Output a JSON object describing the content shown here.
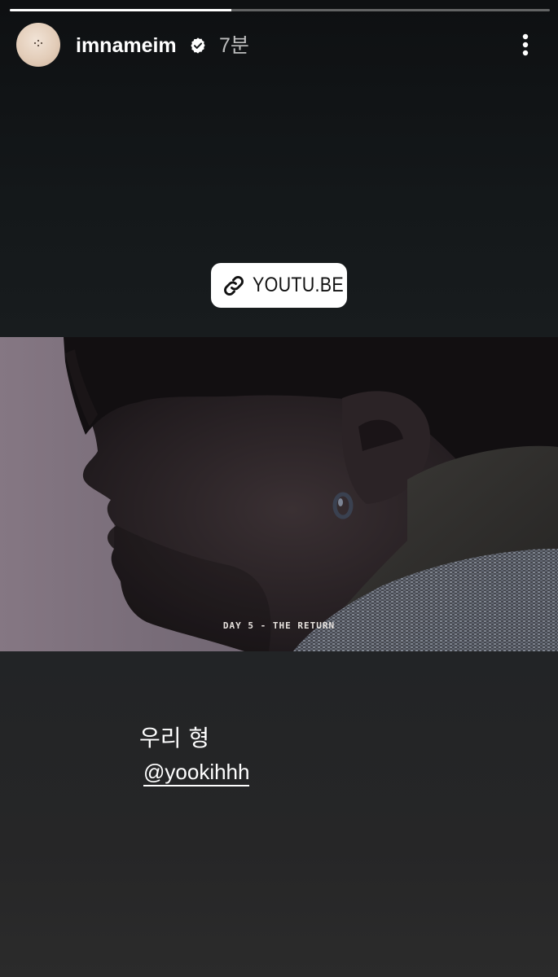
{
  "story": {
    "progress": 0.41,
    "account": {
      "username": "imnameim",
      "verified": true,
      "time_ago": "7분",
      "avatar_icon": "profile-avatar"
    },
    "menu_icon": "more-vertical-icon",
    "link_sticker": {
      "label": "YOUTU.BE",
      "icon": "link-icon"
    },
    "media": {
      "caption": "DAY 5 - THE RETURN"
    },
    "text_overlay": "우리 형",
    "mention": "@yookihhh"
  },
  "colors": {
    "background_top": "#121416",
    "background_bottom": "#2b2b2b",
    "text": "#ffffff",
    "sticker_bg": "#ffffff",
    "sticker_text": "#111111",
    "verified_badge": "#ffffff"
  }
}
